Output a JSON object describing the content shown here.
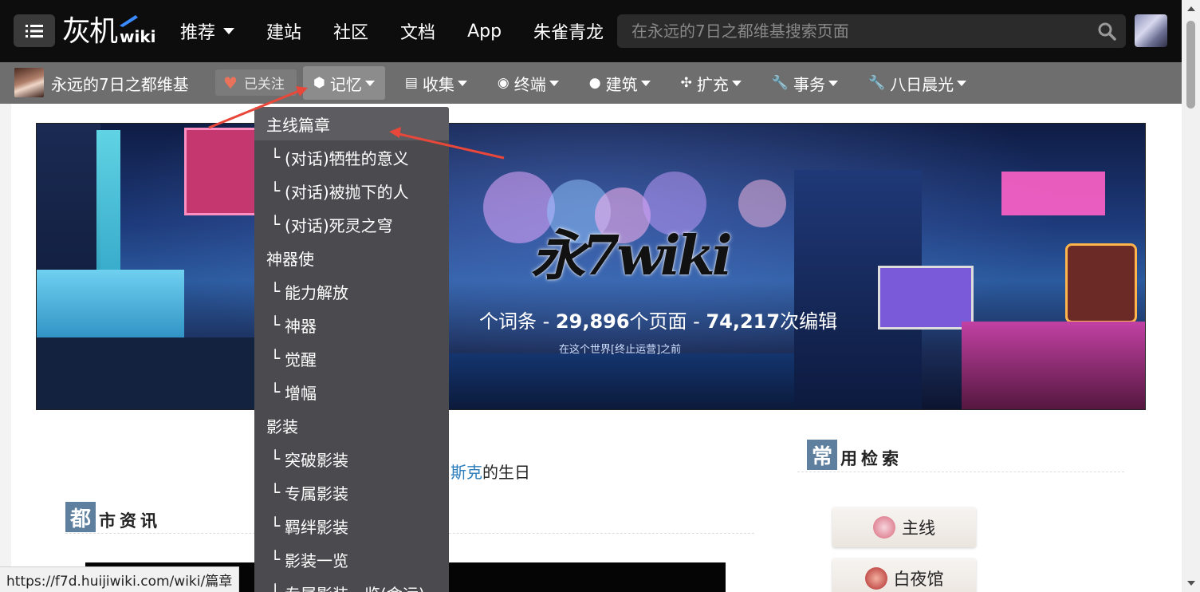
{
  "topbar": {
    "logo_cn": "灰机",
    "logo_wiki": "wiki",
    "nav": [
      {
        "label": "推荐",
        "has_caret": true
      },
      {
        "label": "建站"
      },
      {
        "label": "社区"
      },
      {
        "label": "文档"
      },
      {
        "label": "App"
      },
      {
        "label": "朱雀青龙"
      }
    ],
    "search_placeholder": "在永远的7日之都维基搜索页面",
    "icons": {
      "menu": "list-icon",
      "search": "search-icon",
      "avatar": "user-avatar"
    }
  },
  "subbar": {
    "site_name": "永远的7日之都维基",
    "follow_label": "已关注",
    "nav": [
      {
        "label": "记忆",
        "icon": "cube-icon",
        "glyph": "⬢",
        "active": true
      },
      {
        "label": "收集",
        "icon": "book-icon",
        "glyph": "▤"
      },
      {
        "label": "终端",
        "icon": "broadcast-icon",
        "glyph": "◉"
      },
      {
        "label": "建筑",
        "icon": "globe-icon",
        "glyph": "●"
      },
      {
        "label": "扩充",
        "icon": "joomla-icon",
        "glyph": "✣"
      },
      {
        "label": "事务",
        "icon": "wrench-icon",
        "glyph": "🔧"
      },
      {
        "label": "八日晨光",
        "icon": "wrench-icon",
        "glyph": "🔧"
      }
    ]
  },
  "banner": {
    "logo_text": "永7wiki",
    "stats_prefix": "个词条 - ",
    "pages_count": "29,896",
    "pages_label": "个页面 - ",
    "edits_count": "74,217",
    "edits_label": "次编辑",
    "subtitle": "在这个世界[终止运营]之前"
  },
  "birthday": {
    "link": "斯克",
    "suffix": "的生日"
  },
  "sections": {
    "news": {
      "first": "都",
      "rest": "市资讯"
    },
    "quick": {
      "first": "常",
      "rest": "用检索"
    }
  },
  "quick_links": [
    {
      "label": "主线",
      "color": "#d8677a"
    },
    {
      "label": "白夜馆",
      "color": "#b02a2a"
    }
  ],
  "dropdown": {
    "items": [
      {
        "label": "主线篇章",
        "type": "head",
        "highlight": true
      },
      {
        "label": "(对话)牺牲的意义",
        "type": "sub"
      },
      {
        "label": "(对话)被抛下的人",
        "type": "sub"
      },
      {
        "label": "(对话)死灵之穹",
        "type": "sub"
      },
      {
        "label": "神器使",
        "type": "head"
      },
      {
        "label": "能力解放",
        "type": "sub"
      },
      {
        "label": "神器",
        "type": "sub"
      },
      {
        "label": "觉醒",
        "type": "sub"
      },
      {
        "label": "增幅",
        "type": "sub"
      },
      {
        "label": "影装",
        "type": "head"
      },
      {
        "label": "突破影装",
        "type": "sub"
      },
      {
        "label": "专属影装",
        "type": "sub"
      },
      {
        "label": "羁绊影装",
        "type": "sub"
      },
      {
        "label": "影装一览",
        "type": "sub"
      },
      {
        "label": "专属影装一览(命运)",
        "type": "sub"
      }
    ],
    "branch_glyph": "└"
  },
  "status_url": "https://f7d.huijiwiki.com/wiki/篇章",
  "colors": {
    "accent_arrow": "#e8473a",
    "link": "#2b7dbc",
    "section_badge": "#5e7f9e"
  }
}
